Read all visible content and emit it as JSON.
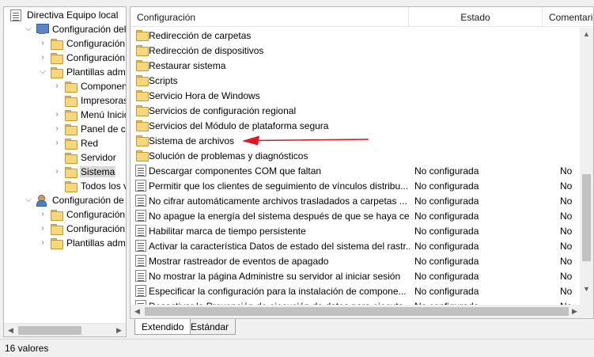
{
  "tree": {
    "items": [
      {
        "label": "Directiva Equipo local",
        "indent": 0,
        "expander": "",
        "icon": "doc"
      },
      {
        "label": "Configuración del equipo",
        "indent": 1,
        "expander": "open",
        "icon": "computer"
      },
      {
        "label": "Configuración de software",
        "indent": 2,
        "expander": "closed",
        "icon": "folder"
      },
      {
        "label": "Configuración de Windows",
        "indent": 2,
        "expander": "closed",
        "icon": "folder"
      },
      {
        "label": "Plantillas administrativas",
        "indent": 2,
        "expander": "open",
        "icon": "folder"
      },
      {
        "label": "Componentes de Windows",
        "indent": 3,
        "expander": "closed",
        "icon": "folder"
      },
      {
        "label": "Impresoras",
        "indent": 3,
        "expander": "",
        "icon": "folder"
      },
      {
        "label": "Menú Inicio y barra de tareas",
        "indent": 3,
        "expander": "closed",
        "icon": "folder"
      },
      {
        "label": "Panel de control",
        "indent": 3,
        "expander": "closed",
        "icon": "folder"
      },
      {
        "label": "Red",
        "indent": 3,
        "expander": "closed",
        "icon": "folder"
      },
      {
        "label": "Servidor",
        "indent": 3,
        "expander": "",
        "icon": "folder"
      },
      {
        "label": "Sistema",
        "indent": 3,
        "expander": "closed",
        "icon": "folder",
        "selected": true
      },
      {
        "label": "Todos los valores",
        "indent": 3,
        "expander": "",
        "icon": "folder-doc"
      },
      {
        "label": "Configuración de usuario",
        "indent": 1,
        "expander": "open",
        "icon": "user"
      },
      {
        "label": "Configuración de software",
        "indent": 2,
        "expander": "closed",
        "icon": "folder"
      },
      {
        "label": "Configuración de Windows",
        "indent": 2,
        "expander": "closed",
        "icon": "folder"
      },
      {
        "label": "Plantillas administrativas",
        "indent": 2,
        "expander": "closed",
        "icon": "folder"
      }
    ]
  },
  "list": {
    "headers": {
      "config": "Configuración",
      "estado": "Estado",
      "comentario": "Comentario"
    },
    "rows": [
      {
        "type": "folder",
        "name": "Redirección de carpetas",
        "state": "",
        "comment": ""
      },
      {
        "type": "folder",
        "name": "Redirección de dispositivos",
        "state": "",
        "comment": ""
      },
      {
        "type": "folder",
        "name": "Restaurar sistema",
        "state": "",
        "comment": ""
      },
      {
        "type": "folder",
        "name": "Scripts",
        "state": "",
        "comment": ""
      },
      {
        "type": "folder",
        "name": "Servicio Hora de Windows",
        "state": "",
        "comment": ""
      },
      {
        "type": "folder",
        "name": "Servicios de configuración regional",
        "state": "",
        "comment": ""
      },
      {
        "type": "folder",
        "name": "Servicios del Módulo de plataforma segura",
        "state": "",
        "comment": ""
      },
      {
        "type": "folder",
        "name": "Sistema de archivos",
        "state": "",
        "comment": ""
      },
      {
        "type": "folder",
        "name": "Solución de problemas y diagnósticos",
        "state": "",
        "comment": ""
      },
      {
        "type": "setting",
        "name": "Descargar componentes COM que faltan",
        "state": "No configurada",
        "comment": "No"
      },
      {
        "type": "setting",
        "name": "Permitir que los clientes de seguimiento de vínculos distribu...",
        "state": "No configurada",
        "comment": "No"
      },
      {
        "type": "setting",
        "name": "No cifrar automáticamente archivos trasladados a carpetas ...",
        "state": "No configurada",
        "comment": "No"
      },
      {
        "type": "setting",
        "name": "No apague la energía del sistema después de que se haya ce...",
        "state": "No configurada",
        "comment": "No"
      },
      {
        "type": "setting",
        "name": "Habilitar marca de tiempo persistente",
        "state": "No configurada",
        "comment": "No"
      },
      {
        "type": "setting",
        "name": "Activar la característica Datos de estado del sistema del rastr...",
        "state": "No configurada",
        "comment": "No"
      },
      {
        "type": "setting",
        "name": "Mostrar rastreador de eventos de apagado",
        "state": "No configurada",
        "comment": "No"
      },
      {
        "type": "setting",
        "name": "No mostrar la página Administre su servidor al iniciar sesión",
        "state": "No configurada",
        "comment": "No"
      },
      {
        "type": "setting",
        "name": "Especificar la configuración para la instalación de compone...",
        "state": "No configurada",
        "comment": "No"
      },
      {
        "type": "setting",
        "name": "Desactivar la Prevención de ejecución de datos para ejecuta...",
        "state": "No configurada",
        "comment": "No"
      }
    ]
  },
  "tabs": {
    "extended": "Extendido",
    "standard": "Estándar"
  },
  "status": {
    "text": "16 valores"
  },
  "colors": {
    "annotation_arrow": "#e8141c",
    "selection": "#d9d9d9",
    "folder": "#f7d77c"
  }
}
